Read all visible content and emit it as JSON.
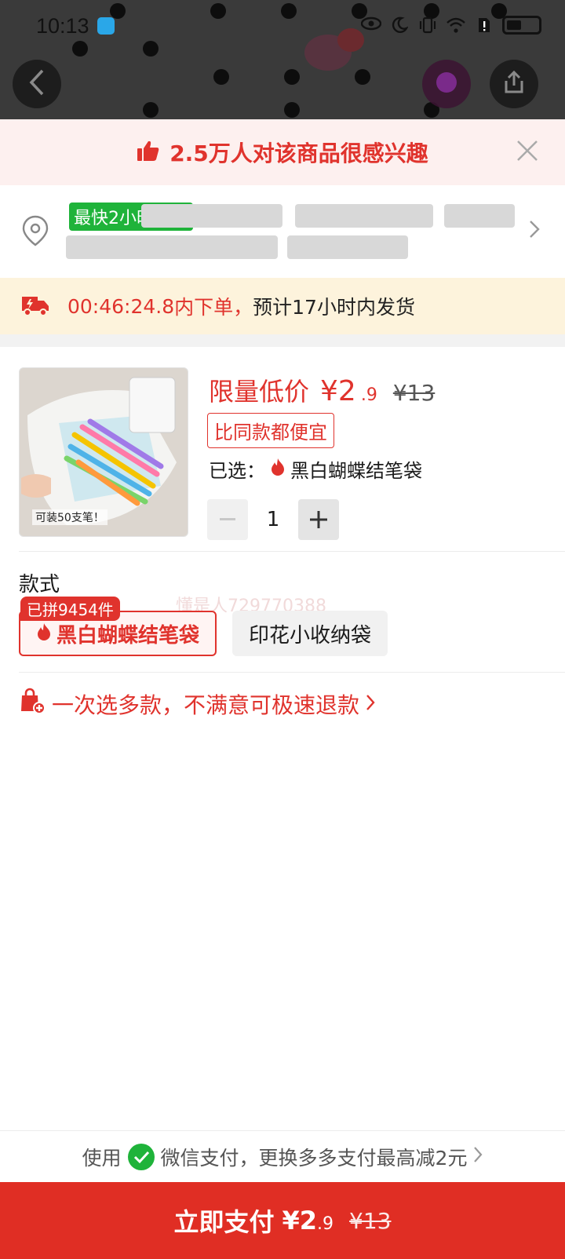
{
  "status_bar": {
    "time": "10:13"
  },
  "interest_banner": {
    "text": "2.5万人对该商品很感兴趣"
  },
  "address": {
    "fast_badge": "最快2小时发货"
  },
  "countdown": {
    "time": "00:46:24.8",
    "suffix": "内下单，",
    "eta": "预计17小时内发货"
  },
  "product": {
    "image_caption": "可装50支笔！",
    "price_label": "限量低价",
    "price_now": "¥2",
    "price_decimal": ".9",
    "price_old": "¥13",
    "cheaper_badge": "比同款都便宜",
    "selected_prefix": "已选：",
    "selected_value": "黑白蝴蝶结笔袋",
    "quantity": "1"
  },
  "style_section": {
    "title": "款式",
    "watermark": "懂是人729770388",
    "options": [
      {
        "label": "黑白蝴蝶结笔袋",
        "badge": "已拼9454件",
        "selected": true
      },
      {
        "label": "印花小收纳袋",
        "selected": false
      }
    ]
  },
  "refund_line": {
    "text": "一次选多款，不满意可极速退款"
  },
  "payment_switch": {
    "prefix": "使用",
    "text": "微信支付，更换多多支付最高减2元"
  },
  "pay_button": {
    "label": "立即支付",
    "price": "¥2",
    "price_decimal": ".9",
    "price_old": "¥13"
  },
  "colors": {
    "accent_red": "#e0332d",
    "pay_button_red": "#e02e24",
    "fast_badge_green": "#1fb33a",
    "interest_bg": "#fdf0ef",
    "countdown_bg": "#fdf3dc"
  },
  "icons": [
    "back-arrow-icon",
    "share-icon",
    "thumbs-up-icon",
    "close-icon",
    "location-pin-icon",
    "chevron-right-icon",
    "delivery-truck-icon",
    "flame-icon",
    "minus-icon",
    "plus-icon",
    "shopping-bag-plus-icon",
    "wechat-pay-icon"
  ]
}
